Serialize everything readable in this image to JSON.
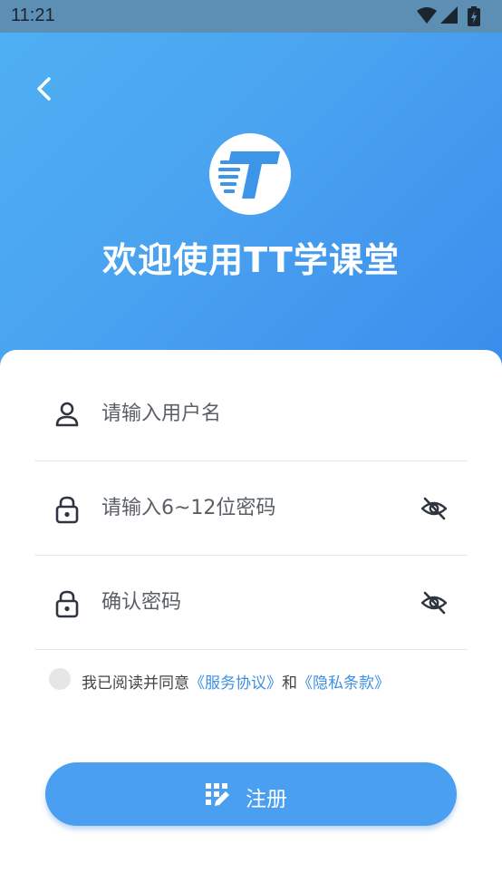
{
  "status_bar": {
    "time": "11:21"
  },
  "header": {
    "title": "欢迎使用TT学课堂"
  },
  "form": {
    "username_placeholder": "请输入用户名",
    "password_placeholder": "请输入6~12位密码",
    "confirm_placeholder": "确认密码"
  },
  "agreement": {
    "prefix": "我已阅读并同意",
    "service_link": "《服务协议》",
    "and": "和",
    "privacy_link": "《隐私条款》"
  },
  "register_button": {
    "label": "注册"
  },
  "colors": {
    "brand_blue": "#4a9ff0",
    "link_blue": "#3d8fe3"
  }
}
